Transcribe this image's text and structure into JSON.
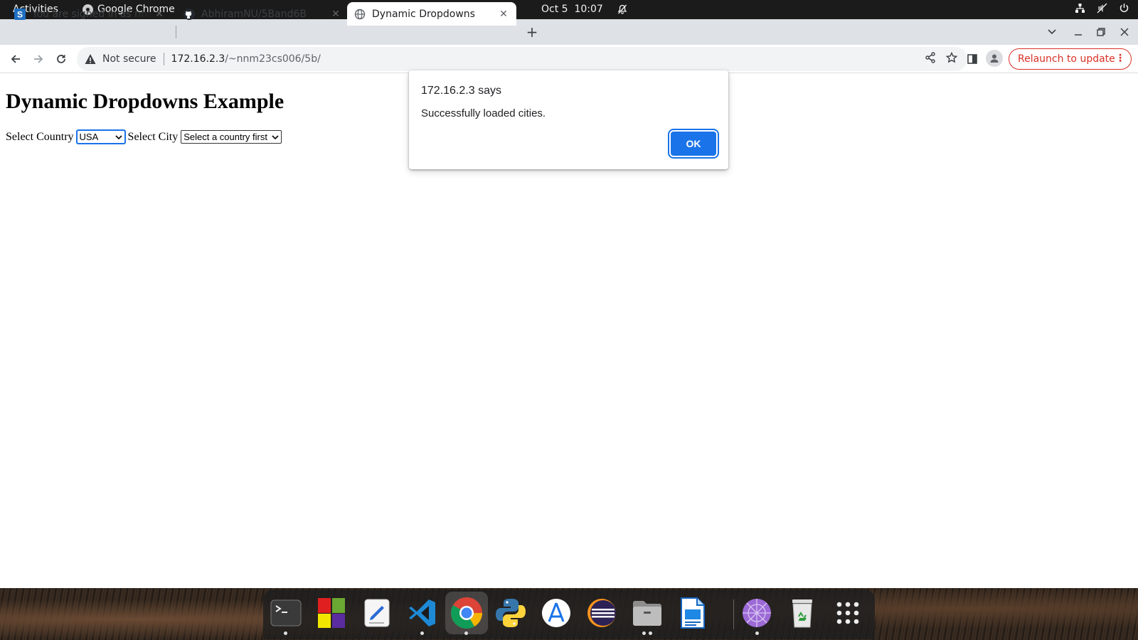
{
  "topbar": {
    "activities": "Activities",
    "app_name": "Google Chrome",
    "date": "Oct 5",
    "time": "10:07"
  },
  "tabs": [
    {
      "title": "You are signed in as nnm23cs006",
      "favicon": "s-icon"
    },
    {
      "title": "AbhiramNU/5Band6B",
      "favicon": "github-icon"
    },
    {
      "title": "Dynamic Dropdowns",
      "favicon": "globe-icon"
    }
  ],
  "address_bar": {
    "security_label": "Not secure",
    "host": "172.16.2.3",
    "path": "/~nnm23cs006/5b/"
  },
  "relaunch_label": "Relaunch to update",
  "page": {
    "heading": "Dynamic Dropdowns Example",
    "country_label": "Select Country",
    "country_value": "USA",
    "city_label": "Select City",
    "city_value": "Select a country first"
  },
  "dialog": {
    "title": "172.16.2.3 says",
    "message": "Successfully loaded cities.",
    "ok_label": "OK"
  },
  "dock": [
    {
      "name": "terminal",
      "running": true
    },
    {
      "name": "blocks-app",
      "running": false
    },
    {
      "name": "text-editor",
      "running": false
    },
    {
      "name": "vscode",
      "running": true
    },
    {
      "name": "chrome",
      "running": true,
      "active": true
    },
    {
      "name": "python",
      "running": false
    },
    {
      "name": "app-store",
      "running": false
    },
    {
      "name": "eclipse",
      "running": false
    },
    {
      "name": "files",
      "running": true
    },
    {
      "name": "writer",
      "running": false
    },
    {
      "name": "network-app",
      "running": true
    },
    {
      "name": "trash",
      "running": false
    },
    {
      "name": "show-apps",
      "running": false
    }
  ],
  "colors": {
    "accent": "#1a73e8",
    "relaunch": "#d93025",
    "topbar": "#1b1b1b",
    "tabstrip": "#dee1e6"
  }
}
